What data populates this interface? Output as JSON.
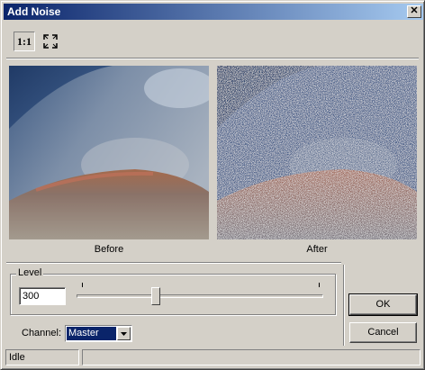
{
  "window": {
    "title": "Add Noise",
    "close_glyph": "✕"
  },
  "toolbar": {
    "zoom_1to1_label": "1:1",
    "fit_icon": "fit-to-window-icon"
  },
  "previews": {
    "before_caption": "Before",
    "after_caption": "After"
  },
  "level": {
    "group_label": "Level",
    "value": "300",
    "slider_position": 0.32
  },
  "channel": {
    "label": "Channel:",
    "selected": "Master"
  },
  "buttons": {
    "ok": "OK",
    "cancel": "Cancel"
  },
  "status": {
    "text": "Idle",
    "secondary": ""
  },
  "colors": {
    "face": "#d4d0c8",
    "title_start": "#0a246a",
    "title_end": "#a6caf0",
    "selection": "#0a246a"
  }
}
